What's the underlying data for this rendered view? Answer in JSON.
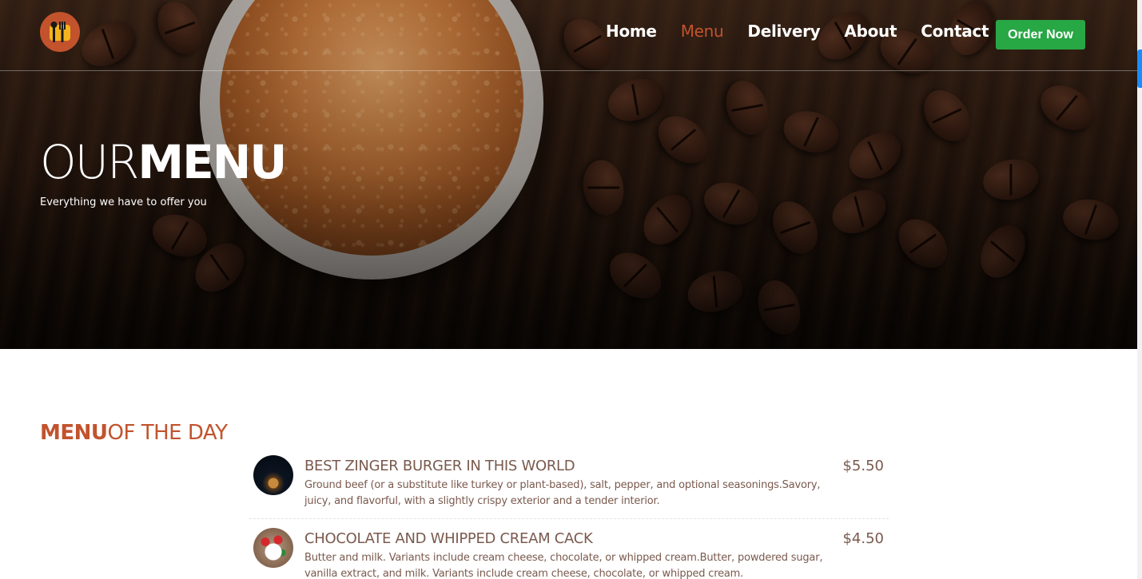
{
  "nav": {
    "logo_icon": "utensils-logo-icon",
    "links": [
      {
        "label": "Home",
        "active": false
      },
      {
        "label": "Menu",
        "active": true
      },
      {
        "label": "Delivery",
        "active": false
      },
      {
        "label": "About",
        "active": false
      },
      {
        "label": "Contact",
        "active": false
      }
    ],
    "order_button": "Order Now"
  },
  "hero": {
    "title_light": "OUR",
    "title_bold": "MENU",
    "subtitle": "Everything we have to offer you"
  },
  "menu_section": {
    "heading_bold": "MENU",
    "heading_light": "OF THE DAY",
    "items": [
      {
        "name": "BEST ZINGER BURGER IN THIS WORLD",
        "price": "$5.50",
        "description": "Ground beef (or a substitute like turkey or plant-based), salt, pepper, and optional seasonings.Savory, juicy, and flavorful, with a slightly crispy exterior and a tender interior."
      },
      {
        "name": "CHOCOLATE AND WHIPPED CREAM CACK",
        "price": "$4.50",
        "description": "Butter and milk. Variants include cream cheese, chocolate, or whipped cream.Butter, powdered sugar, vanilla extract, and milk. Variants include cream cheese, chocolate, or whipped cream."
      }
    ]
  },
  "colors": {
    "accent": "#c2532d",
    "order_button": "#28a745",
    "menu_text": "#7a5a4e"
  }
}
